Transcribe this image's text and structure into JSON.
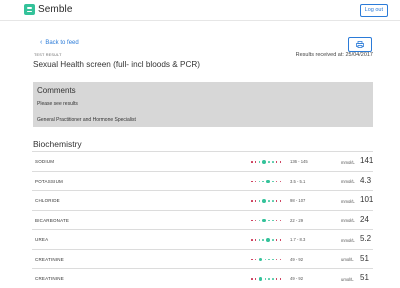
{
  "header": {
    "brand": "Semble",
    "logout_label": "Log out"
  },
  "back_label": "Back to feed",
  "test_label": "TEST RESULT",
  "received_label": "Results received at:",
  "received_date": "25/04/2017",
  "title": "Sexual Health screen (full- incl bloods & PCR)",
  "comments": {
    "heading": "Comments",
    "line1": "Please see results",
    "line2": "General Practitioner and Hormone Specialist"
  },
  "section_title": "Biochemistry",
  "results": [
    {
      "name": "SODIUM",
      "range": "136 - 145",
      "unit": "mmol/L",
      "value": "141",
      "marker_index": 3
    },
    {
      "name": "POTASSIUM",
      "range": "3.5 - 5.1",
      "unit": "mmol/L",
      "value": "4.3",
      "marker_index": 4
    },
    {
      "name": "CHLORIDE",
      "range": "98 - 107",
      "unit": "mmol/L",
      "value": "101",
      "marker_index": 3
    },
    {
      "name": "BICARBONATE",
      "range": "22 - 29",
      "unit": "mmol/L",
      "value": "24",
      "marker_index": 3
    },
    {
      "name": "UREA",
      "range": "1.7 - 8.3",
      "unit": "mmol/L",
      "value": "5.2",
      "marker_index": 4
    },
    {
      "name": "CREATININE",
      "range": "49 - 92",
      "unit": "umol/L",
      "value": "51",
      "marker_index": 2
    },
    {
      "name": "CREATININE",
      "range": "49 - 92",
      "unit": "umol/L",
      "value": "51",
      "marker_index": 2
    }
  ],
  "colors": {
    "accent": "#34c29a",
    "link": "#2b7bd8",
    "low_high": "#c72a4b",
    "comments_bg": "#d7d7d7"
  },
  "icons": {
    "logo": "semble-logo-icon",
    "print": "printer-icon",
    "back": "chevron-left-icon"
  }
}
